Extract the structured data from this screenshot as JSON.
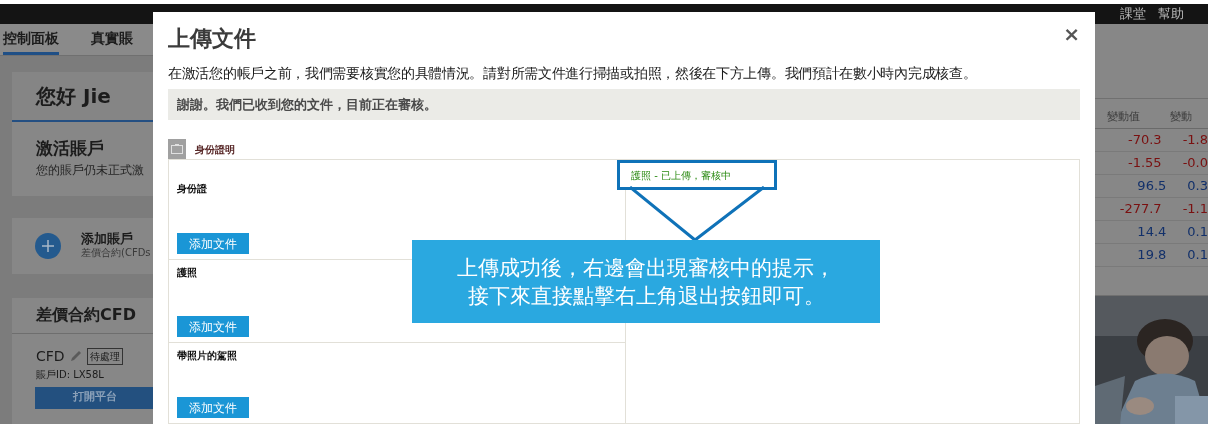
{
  "top_nav": {
    "links": [
      "課堂",
      "幫助"
    ]
  },
  "background": {
    "tabs": [
      {
        "label": "控制面板",
        "selected": true
      },
      {
        "label": "真實賬",
        "selected": false
      }
    ],
    "greeting": "您好 Jie",
    "activate_card": {
      "title": "激活賬戶",
      "text": "您的賬戶仍未正式激"
    },
    "add_account": {
      "title": "添加賬戶",
      "subtitle": "差價合約(CFDs"
    },
    "cfd_section": {
      "title": "差價合約CFD",
      "account_name": "CFD",
      "status": "待處理",
      "account_id": "賬戶ID: LX58L",
      "button": "打開平台"
    },
    "quotes": {
      "columns": [
        "變動值",
        "變動"
      ],
      "rows": [
        {
          "change": "-70.3",
          "percent": "-1.8",
          "color": "#7a1010"
        },
        {
          "change": "-1.55",
          "percent": "-0.0",
          "color": "#7a1010"
        },
        {
          "change": "96.5",
          "percent": "0.3",
          "color": "#12306a"
        },
        {
          "change": "-277.7",
          "percent": "-1.1",
          "color": "#7a1010"
        },
        {
          "change": "14.4",
          "percent": "0.1",
          "color": "#12306a"
        },
        {
          "change": "19.8",
          "percent": "0.1",
          "color": "#12306a"
        }
      ]
    }
  },
  "dialog": {
    "title": "上傳文件",
    "close": "×",
    "description": "在激活您的帳戶之前，我們需要核實您的具體情況。請對所需文件進行掃描或拍照，然後在下方上傳。我們預計在數小時內完成核查。",
    "notice": "謝謝。我們已收到您的文件，目前正在審核。",
    "section_title": "身份證明",
    "documents": [
      {
        "label": "身份證",
        "button": "添加文件"
      },
      {
        "label": "護照",
        "button": "添加文件"
      },
      {
        "label": "帶照片的駕照",
        "button": "添加文件"
      }
    ],
    "upload_status": "護照 - 已上傳，審核中"
  },
  "callout": {
    "lines": [
      "上傳成功後，右邊會出現審核中的提示，",
      "接下來直接點擊右上角退出按鈕即可。"
    ]
  }
}
